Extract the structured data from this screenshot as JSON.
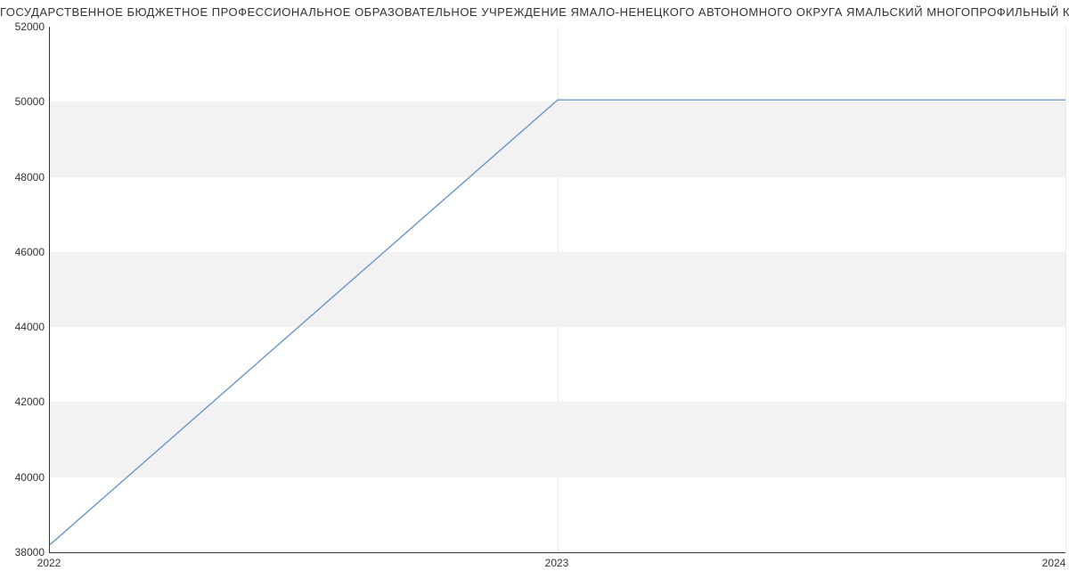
{
  "chart_data": {
    "type": "line",
    "title": "ГОСУДАРСТВЕННОЕ БЮДЖЕТНОЕ ПРОФЕССИОНАЛЬНОЕ ОБРАЗОВАТЕЛЬНОЕ УЧРЕЖДЕНИЕ ЯМАЛО-НЕНЕЦКОГО АВТОНОМНОГО ОКРУГА ЯМАЛЬСКИЙ МНОГОПРОФИЛЬНЫЙ КОЛЛЕДЖ",
    "x": [
      2022,
      2023,
      2024
    ],
    "values": [
      38200,
      50050,
      50050
    ],
    "xlabel": "",
    "ylabel": "",
    "xlim": [
      2022,
      2024
    ],
    "ylim": [
      38000,
      52000
    ],
    "xticks": [
      2022,
      2023,
      2024
    ],
    "yticks": [
      38000,
      40000,
      42000,
      44000,
      46000,
      48000,
      50000,
      52000
    ],
    "xtick_labels": [
      "2022",
      "2023",
      "2024"
    ],
    "ytick_labels": [
      "38000",
      "40000",
      "42000",
      "44000",
      "46000",
      "48000",
      "50000",
      "52000"
    ],
    "grid": true,
    "line_color": "#6b96c9"
  }
}
